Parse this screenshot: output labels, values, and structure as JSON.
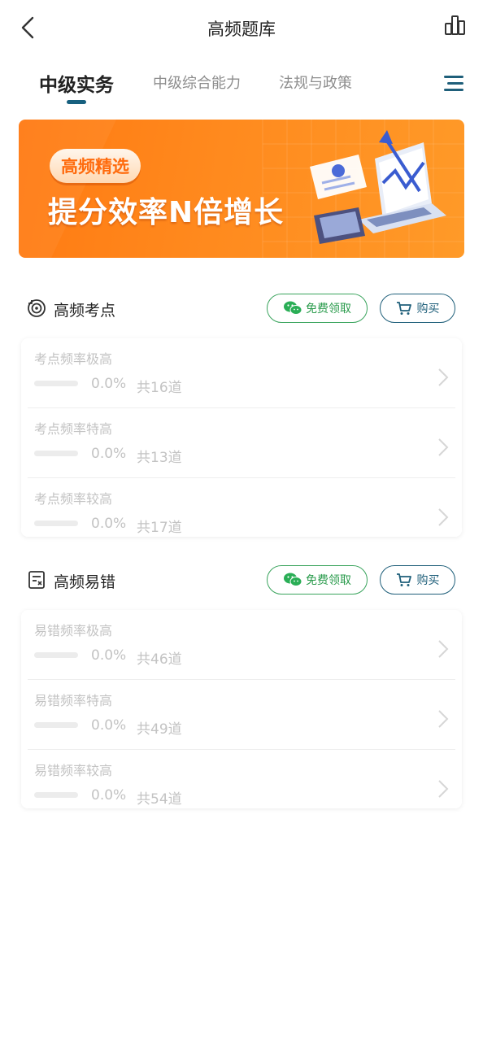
{
  "header": {
    "title": "高频题库",
    "back_icon": "chevron-left-icon",
    "stats_icon": "bar-chart-icon"
  },
  "tabs": [
    {
      "label": "中级实务",
      "active": true
    },
    {
      "label": "中级综合能力",
      "active": false
    },
    {
      "label": "法规与政策",
      "active": false
    }
  ],
  "tabs_menu_icon": "hamburger-menu-icon",
  "banner": {
    "badge": "高频精选",
    "slogan": "提分效率N倍增长"
  },
  "colors": {
    "accent": "#17607f",
    "wechat_green": "#2a9b4c",
    "banner_orange": "#ff8a1e"
  },
  "sections": [
    {
      "title": "高频考点",
      "icon": "target-icon",
      "free_label": "免费领取",
      "buy_label": "购买",
      "items": [
        {
          "title": "考点频率极高",
          "progress": "0.0%",
          "progress_value": 0,
          "count": "共16道"
        },
        {
          "title": "考点频率特高",
          "progress": "0.0%",
          "progress_value": 0,
          "count": "共13道"
        },
        {
          "title": "考点频率较高",
          "progress": "0.0%",
          "progress_value": 0,
          "count": "共17道"
        }
      ]
    },
    {
      "title": "高频易错",
      "icon": "error-sheet-icon",
      "free_label": "免费领取",
      "buy_label": "购买",
      "items": [
        {
          "title": "易错频率极高",
          "progress": "0.0%",
          "progress_value": 0,
          "count": "共46道"
        },
        {
          "title": "易错频率特高",
          "progress": "0.0%",
          "progress_value": 0,
          "count": "共49道"
        },
        {
          "title": "易错频率较高",
          "progress": "0.0%",
          "progress_value": 0,
          "count": "共54道"
        }
      ]
    }
  ]
}
